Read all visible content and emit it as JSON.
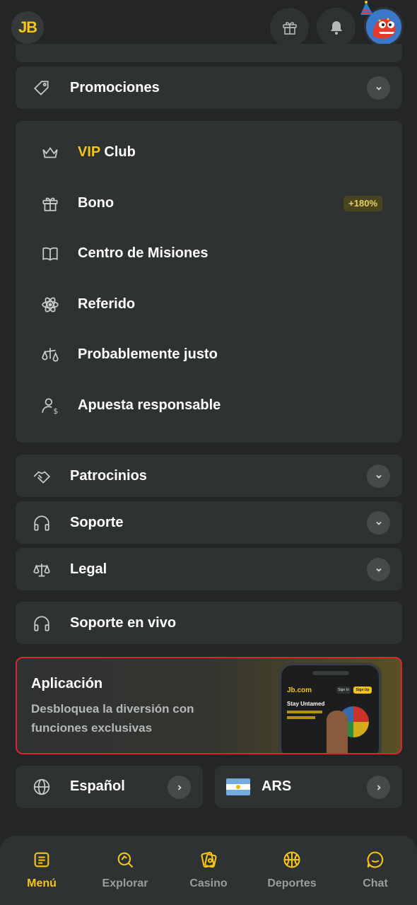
{
  "header": {
    "logo_text": "JB",
    "gift_icon": "gift-icon",
    "bell_icon": "bell-icon",
    "avatar_icon": "dino-avatar-icon"
  },
  "menu": {
    "promociones": "Promociones",
    "vip_prefix": "VIP",
    "vip_suffix": " Club",
    "bono": "Bono",
    "bono_badge": "+180%",
    "misiones": "Centro de Misiones",
    "referido": "Referido",
    "justo": "Probablemente justo",
    "responsable": "Apuesta responsable",
    "patrocinios": "Patrocinios",
    "soporte": "Soporte",
    "legal": "Legal",
    "soporte_vivo": "Soporte en vivo"
  },
  "app_banner": {
    "title": "Aplicación",
    "description": "Desbloquea la diversión con funciones exclusivas",
    "phone_brand": "Jb.com",
    "phone_heading": "Stay Untamed",
    "phone_signin": "Sign In",
    "phone_signup": "Sign Up"
  },
  "settings": {
    "language": "Español",
    "currency": "ARS"
  },
  "bottom_nav": [
    {
      "label": "Menú",
      "icon": "menu-icon",
      "active": true
    },
    {
      "label": "Explorar",
      "icon": "explore-icon",
      "active": false
    },
    {
      "label": "Casino",
      "icon": "casino-icon",
      "active": false
    },
    {
      "label": "Deportes",
      "icon": "sports-ball-icon",
      "active": false
    },
    {
      "label": "Chat",
      "icon": "chat-icon",
      "active": false
    }
  ],
  "colors": {
    "background": "#232526",
    "card": "#2f3233",
    "accent": "#f5c518",
    "highlight_border": "#d8262c"
  }
}
